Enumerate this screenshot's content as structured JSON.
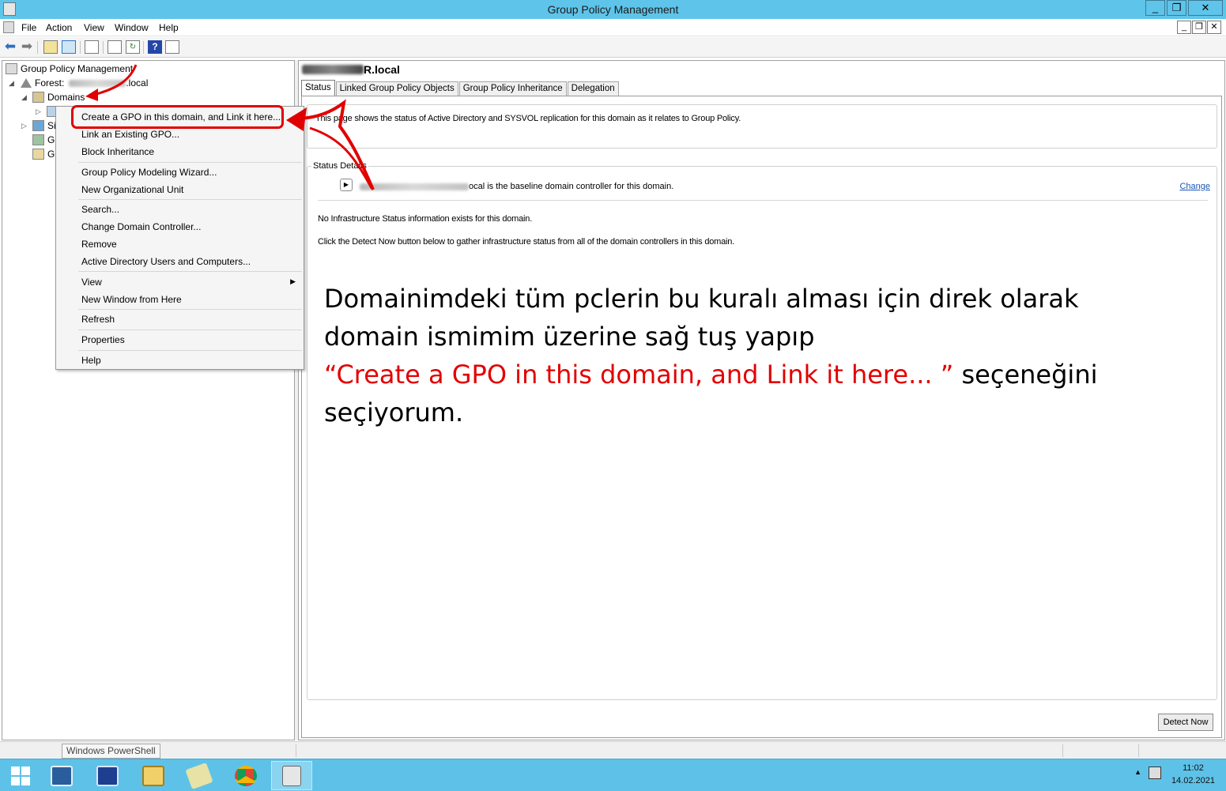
{
  "window": {
    "title": "Group Policy Management",
    "controls": {
      "minimize": "_",
      "restore": "❐",
      "close": "✕"
    }
  },
  "menubar": {
    "items": [
      "File",
      "Action",
      "View",
      "Window",
      "Help"
    ],
    "mdi_controls": {
      "minimize": "_",
      "restore": "❐",
      "close": "✕"
    }
  },
  "toolbar": {
    "icons": [
      "back-arrow-icon",
      "forward-arrow-icon",
      "up-folder-icon",
      "show-hide-tree-icon",
      "copy-icon",
      "export-list-icon",
      "refresh-icon",
      "help-icon",
      "show-pane-icon"
    ]
  },
  "tree": {
    "root": "Group Policy Management",
    "forest_prefix": "Forest:",
    "forest_suffix": ".local",
    "domains": "Domains",
    "site_stub": "Si",
    "g1_stub": "G",
    "g2_stub": "G"
  },
  "right_pane": {
    "domain_suffix": "R.local",
    "tabs": [
      "Status",
      "Linked Group Policy Objects",
      "Group Policy Inheritance",
      "Delegation"
    ],
    "active_tab": "Status",
    "intro": "This page shows the status of Active Directory and SYSVOL replication for this domain as it relates to Group Policy.",
    "status_details_label": "Status Details",
    "dc_line_suffix": "ocal is the baseline domain controller for this domain.",
    "change_link": "Change",
    "no_infra": "No Infrastructure Status information exists for this domain.",
    "click_detect": "Click the Detect Now button below to gather infrastructure status from all of the domain controllers in this domain.",
    "detect_button": "Detect Now"
  },
  "context_menu": {
    "items": [
      "Create a GPO in this domain, and Link it here...",
      "Link an Existing GPO...",
      "Block Inheritance",
      "Group Policy Modeling Wizard...",
      "New Organizational Unit",
      "Search...",
      "Change Domain Controller...",
      "Remove",
      "Active Directory Users and Computers...",
      "View",
      "New Window from Here",
      "Refresh",
      "Properties",
      "Help"
    ],
    "highlighted": "Create a GPO in this domain, and Link it here..."
  },
  "annotation": {
    "line1": "Domainimdeki tüm pclerin bu kuralı alması için direk olarak",
    "line2": "domain ismimim üzerine sağ tuş yapıp",
    "line3_red": " “Create a GPO in this domain, and Link it here... ”",
    "line3_black": " seçeneğini",
    "line4": "seçiyorum.",
    "accent_color": "#e20000"
  },
  "statusbar": {
    "tooltip": "Windows PowerShell"
  },
  "taskbar": {
    "icons": [
      "windows-start-icon",
      "server-manager-icon",
      "powershell-icon",
      "file-explorer-icon",
      "notepad-icon",
      "chrome-icon",
      "group-policy-management-icon"
    ],
    "active": "group-policy-management-icon",
    "time": "11:02",
    "date": "14.02.2021"
  }
}
